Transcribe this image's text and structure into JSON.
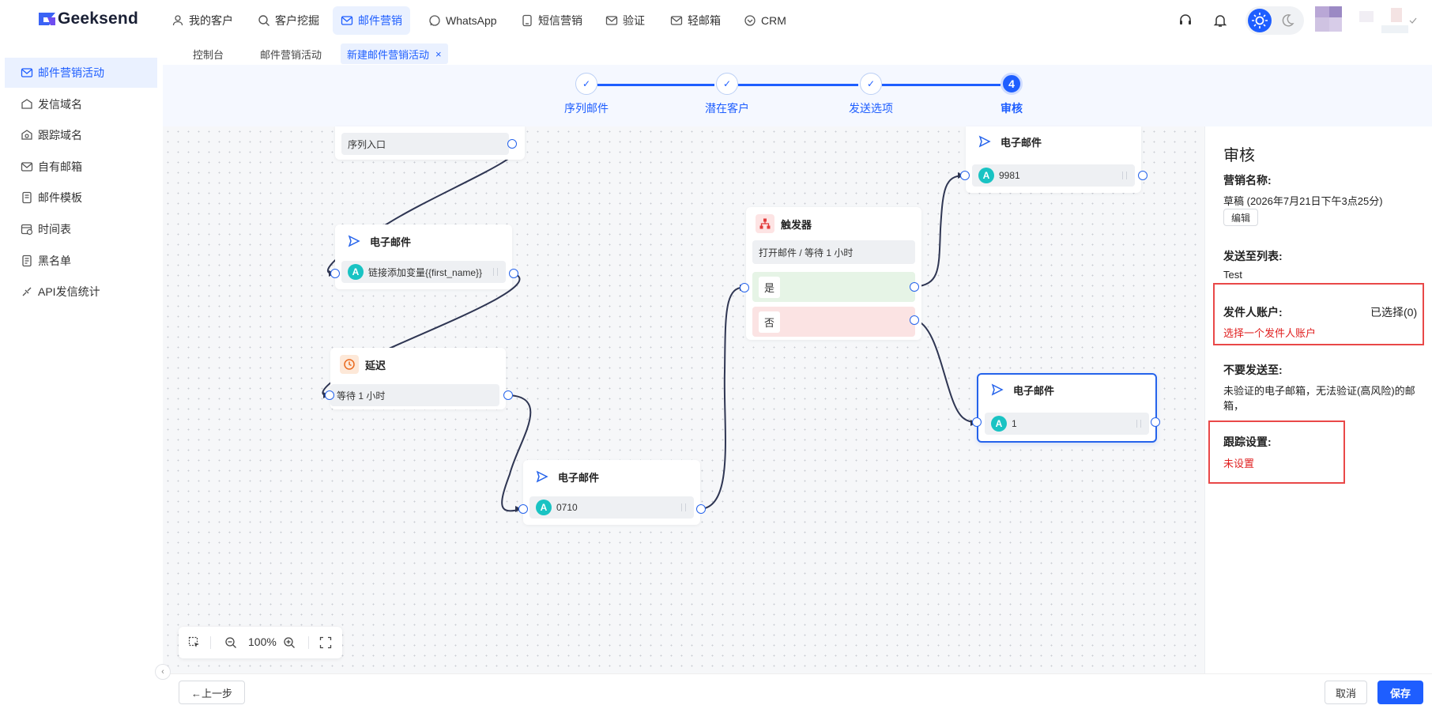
{
  "brand": "Geeksend",
  "nav": {
    "items": [
      "我的客户",
      "客户挖掘",
      "邮件营销",
      "WhatsApp",
      "短信营销",
      "验证",
      "轻邮箱",
      "CRM"
    ],
    "active": "邮件营销"
  },
  "tabs": {
    "t0": "控制台",
    "t1": "邮件营销活动",
    "t2": "新建邮件营销活动",
    "close": "×"
  },
  "sidebar": {
    "items": [
      "邮件营销活动",
      "发信域名",
      "跟踪域名",
      "自有邮箱",
      "邮件模板",
      "时间表",
      "黑名单",
      "API发信统计"
    ],
    "active": "邮件营销活动"
  },
  "stepper": {
    "steps": [
      "序列邮件",
      "潜在客户",
      "发送选项",
      "审核"
    ],
    "current_number": "4",
    "done_mark": "✓"
  },
  "flow": {
    "entry": "序列入口",
    "email_label": "电子邮件",
    "email1_row": "链接添加变量{{first_name}}",
    "delay_title": "延迟",
    "delay_row": "等待 1 小时",
    "email2_row": "0710",
    "trigger_title": "触发器",
    "trigger_row": "打开邮件 / 等待 1 小时",
    "yes": "是",
    "no": "否",
    "email3_row": "9981",
    "email4_row": "1",
    "avatar_letter": "A"
  },
  "zoom": {
    "level": "100%"
  },
  "panel": {
    "title": "审核",
    "campaign_name_label": "营销名称:",
    "campaign_name_value": "草稿 (2026年7月21日下午3点25分)",
    "edit_button": "编辑",
    "send_list_label": "发送至列表:",
    "send_list_value": "Test",
    "sender_label": "发件人账户:",
    "sender_selected": "已选择(0)",
    "sender_warning": "选择一个发件人账户",
    "exclude_label": "不要发送至:",
    "exclude_value_line1": "未验证的电子邮箱，无法验证(高风险)的邮",
    "exclude_value_line2": "箱，",
    "tracking_label": "跟踪设置:",
    "tracking_value": "未设置"
  },
  "footer": {
    "prev": "←上一步",
    "cancel": "取消",
    "save": "保存"
  },
  "colors": {
    "accent": "#1e5eff",
    "danger": "#e02020",
    "teal": "#19c3c3"
  }
}
